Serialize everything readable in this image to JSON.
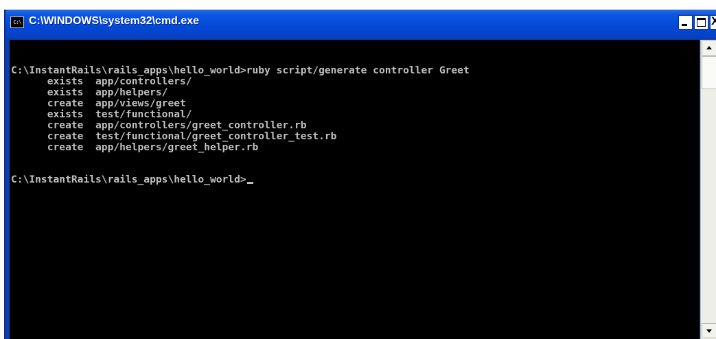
{
  "window": {
    "title": "C:\\WINDOWS\\system32\\cmd.exe",
    "icon_label": "C:\\",
    "title_bar_color": "#0548d6",
    "console_background": "#000000",
    "console_text_color": "#c0c0c0",
    "controls": {
      "minimize_icon": "minimize-icon",
      "maximize_icon": "maximize-icon",
      "close_label": "X"
    }
  },
  "console": {
    "lines": [
      "C:\\InstantRails\\rails_apps\\hello_world>ruby script/generate controller Greet",
      "      exists  app/controllers/",
      "      exists  app/helpers/",
      "      create  app/views/greet",
      "      exists  test/functional/",
      "      create  app/controllers/greet_controller.rb",
      "      create  test/functional/greet_controller_test.rb",
      "      create  app/helpers/greet_helper.rb",
      "",
      "C:\\InstantRails\\rails_apps\\hello_world>"
    ]
  },
  "scrollbar": {
    "up_icon": "arrow-up-icon",
    "down_icon": "arrow-down-icon"
  }
}
